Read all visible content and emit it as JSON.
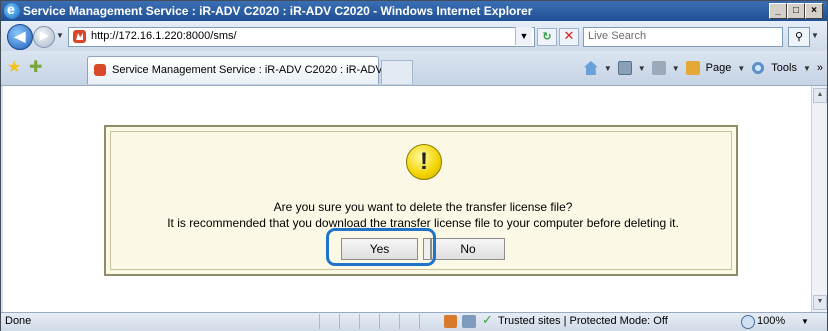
{
  "window": {
    "title": "Service Management Service : iR-ADV C2020 : iR-ADV C2020 - Windows Internet Explorer",
    "controls": [
      "_",
      "□",
      "×"
    ]
  },
  "address_bar": {
    "url": "http://172.16.1.220:8000/sms/",
    "search_placeholder": "Live Search"
  },
  "tab": {
    "title": "Service Management Service : iR-ADV C2020 : iR-ADV..."
  },
  "command_bar": {
    "page_label": "Page",
    "tools_label": "Tools",
    "overflow": "»"
  },
  "dialog": {
    "icon": "!",
    "message_line1": "Are you sure you want to delete the transfer license file?",
    "message_line2": "It is recommended that you download the transfer license file to your computer before deleting it.",
    "yes_label": "Yes",
    "no_label": "No"
  },
  "status_bar": {
    "status": "Done",
    "zone": "Trusted sites | Protected Mode: Off",
    "zoom": "100%"
  },
  "colors": {
    "highlight": "#1f74c8",
    "dialog_bg": "#fbf8e6",
    "titlebar": "#2a5da3"
  },
  "icons": [
    "ie-icon",
    "back-icon",
    "forward-icon",
    "refresh-icon",
    "stop-icon",
    "search-icon",
    "favorites-star-icon",
    "add-favorite-icon",
    "home-icon",
    "feeds-icon",
    "print-icon",
    "page-icon",
    "tools-icon",
    "warning-icon",
    "protected-mode-icon",
    "trusted-sites-check-icon",
    "zoom-icon"
  ]
}
